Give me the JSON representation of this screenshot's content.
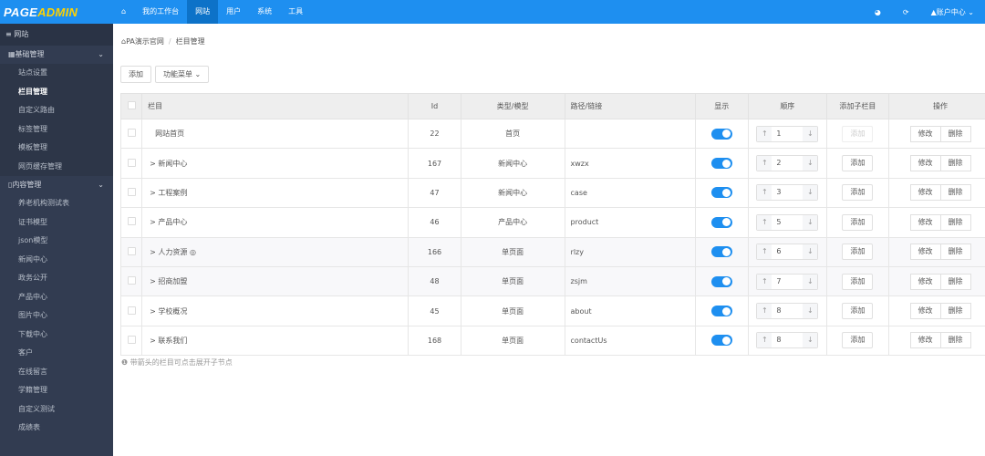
{
  "header": {
    "logo_a": "PAGE",
    "logo_b": "ADMIN",
    "nav": [
      {
        "label": "⌂",
        "icon": "home-icon"
      },
      {
        "label": "我的工作台"
      },
      {
        "label": "网站",
        "active": true
      },
      {
        "label": "用户"
      },
      {
        "label": "系统"
      },
      {
        "label": "工具"
      }
    ],
    "globe_icon": "◕",
    "refresh_icon": "⟳",
    "account": "▲账户中心 ⌄"
  },
  "sidebar": {
    "title": "≡ 网站",
    "groups": [
      {
        "label": "▦基础管理",
        "items": [
          "站点设置",
          "栏目管理",
          "自定义路由",
          "标签管理",
          "模板管理",
          "网页缓存管理"
        ]
      },
      {
        "label": "▯内容管理",
        "items": [
          "养老机构测试表",
          "证书模型",
          "json模型",
          "新闻中心",
          "政务公开",
          "产品中心",
          "图片中心",
          "下载中心",
          "客户",
          "在线留言",
          "学籍管理",
          "自定义测试",
          "成绩表"
        ]
      }
    ],
    "active": "栏目管理"
  },
  "breadcrumb": {
    "home": "⌂PA演示官网",
    "current": "栏目管理"
  },
  "toolbar": {
    "add": "添加",
    "menu": "功能菜单 ⌄"
  },
  "table": {
    "headers": [
      "栏目",
      "Id",
      "类型/模型",
      "路径/链接",
      "显示",
      "顺序",
      "添加子栏目",
      "操作"
    ],
    "rows": [
      {
        "name": "网站首页",
        "id": "22",
        "type": "首页",
        "path": "",
        "show": true,
        "order": "1",
        "add": "添加",
        "add_disabled": true
      },
      {
        "name": "> 新闻中心",
        "id": "167",
        "type": "新闻中心",
        "path": "xwzx",
        "show": true,
        "order": "2",
        "add": "添加"
      },
      {
        "name": "> 工程案例",
        "id": "47",
        "type": "新闻中心",
        "path": "case",
        "show": true,
        "order": "3",
        "add": "添加"
      },
      {
        "name": "> 产品中心",
        "id": "46",
        "type": "产品中心",
        "path": "product",
        "show": true,
        "order": "5",
        "add": "添加"
      },
      {
        "name": "> 人力资源 ◎",
        "id": "166",
        "type": "单页面",
        "path": "rlzy",
        "show": true,
        "order": "6",
        "add": "添加"
      },
      {
        "name": "> 招商加盟",
        "id": "48",
        "type": "单页面",
        "path": "zsjm",
        "show": true,
        "order": "7",
        "add": "添加"
      },
      {
        "name": "> 学校概况",
        "id": "45",
        "type": "单页面",
        "path": "about",
        "show": true,
        "order": "8",
        "add": "添加"
      },
      {
        "name": "> 联系我们",
        "id": "168",
        "type": "单页面",
        "path": "contactUs",
        "show": true,
        "order": "8",
        "add": "添加"
      }
    ],
    "up": "↑",
    "down": "↓",
    "edit": "修改",
    "delete": "删除"
  },
  "note": "❶ 带箭头的栏目可点击展开子节点",
  "colors": {
    "primary": "#1e8ff0",
    "sidebar": "#323c51",
    "logo_accent": "#ffd200"
  }
}
